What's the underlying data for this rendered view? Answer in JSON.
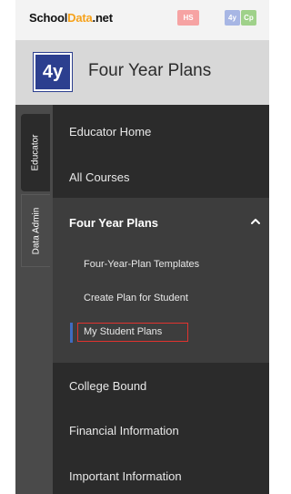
{
  "topbar": {
    "logo": {
      "school": "School",
      "data": "Data",
      "net": ".net"
    },
    "app_buttons": [
      "HS",
      "4y",
      "Cp"
    ]
  },
  "header": {
    "badge": "4y",
    "title": "Four Year Plans"
  },
  "vertical_tabs": [
    "Educator",
    "Data Admin"
  ],
  "menu": {
    "educator_home": "Educator Home",
    "all_courses": "All Courses",
    "section_title": "Four Year Plans",
    "sub_items": [
      "Four-Year-Plan Templates",
      "Create Plan for Student",
      "My Student Plans"
    ],
    "college_bound": "College Bound",
    "financial_information": "Financial Information",
    "important_information": "Important Information"
  },
  "colors": {
    "brand_orange": "#f6a21b",
    "badge_blue": "#2c3f8f",
    "active_indicator": "#3f6cc0",
    "highlight_red": "#e0332f",
    "menu_bg": "#2b2b2b",
    "section_bg": "#3d3d3d"
  }
}
